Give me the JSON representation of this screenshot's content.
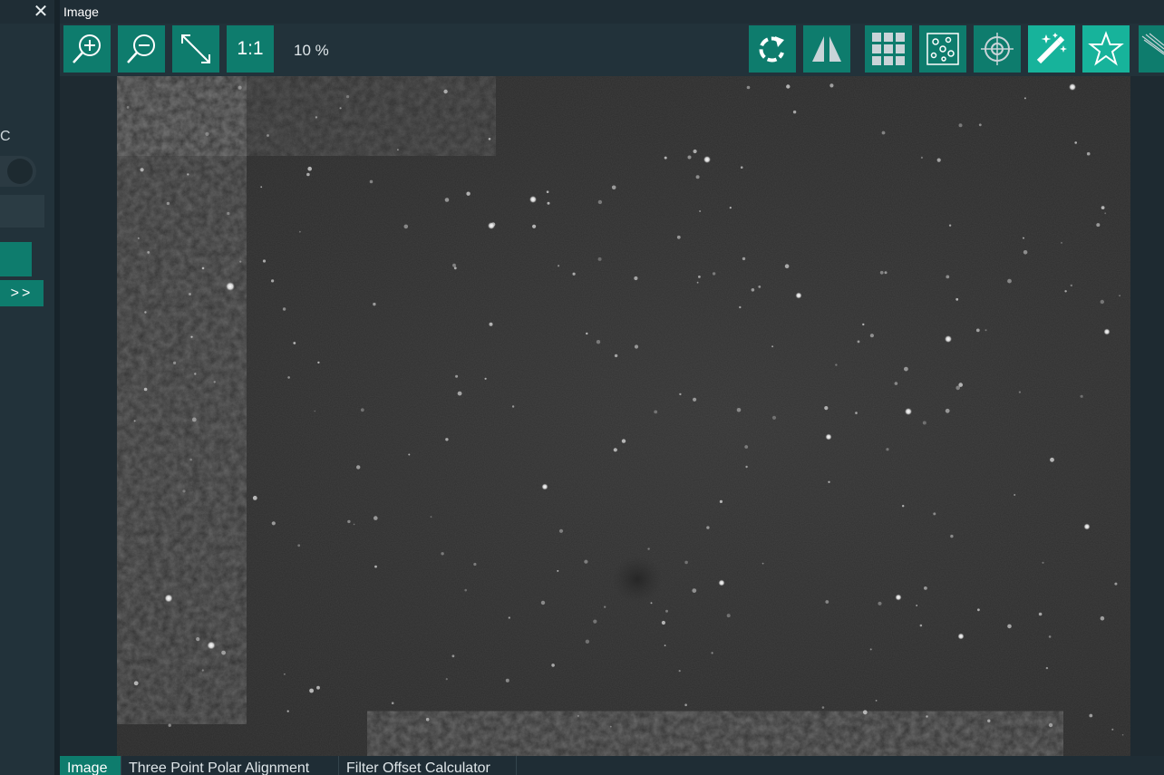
{
  "left_panel": {
    "close_glyph": "✕",
    "label_fragment": "C",
    "expand_label": ">>"
  },
  "image_panel": {
    "title": "Image",
    "zoom_level": "10 %",
    "toolbar_left": [
      {
        "name": "zoom-in-icon"
      },
      {
        "name": "zoom-out-icon"
      },
      {
        "name": "fit-to-screen-icon"
      },
      {
        "name": "one-to-one",
        "label": "1:1"
      }
    ],
    "toolbar_right": [
      {
        "name": "rotate-icon"
      },
      {
        "name": "flip-icon"
      },
      {
        "name": "grid-icon"
      },
      {
        "name": "star-detection-icon"
      },
      {
        "name": "crosshair-icon"
      },
      {
        "name": "auto-stretch-icon",
        "active": true
      },
      {
        "name": "star-icon",
        "active": true
      },
      {
        "name": "bahtinov-icon"
      }
    ]
  },
  "tabs": [
    {
      "label": "Image",
      "active": true
    },
    {
      "label": "Three Point Polar Alignment",
      "active": false
    },
    {
      "label": "Filter Offset Calculator",
      "active": false
    }
  ],
  "colors": {
    "accent": "#0e7c6d",
    "accent_light": "#17b39b",
    "panel": "#22323a",
    "background": "#1c2b33"
  }
}
